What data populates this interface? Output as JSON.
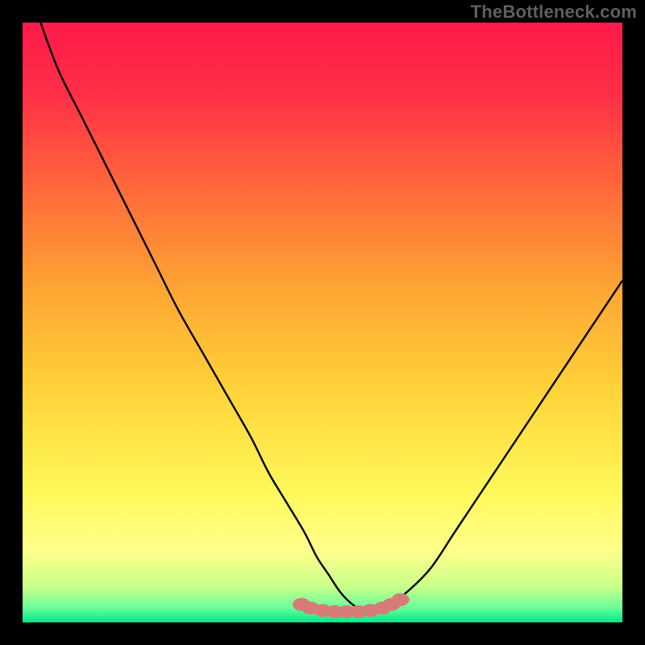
{
  "watermark": "TheBottleneck.com",
  "colors": {
    "background": "#000000",
    "gradient_stops": [
      {
        "offset": 0.0,
        "color": "#ff1a4a"
      },
      {
        "offset": 0.12,
        "color": "#ff2f47"
      },
      {
        "offset": 0.28,
        "color": "#ff6a3a"
      },
      {
        "offset": 0.45,
        "color": "#ffa733"
      },
      {
        "offset": 0.62,
        "color": "#ffd43a"
      },
      {
        "offset": 0.78,
        "color": "#fff85a"
      },
      {
        "offset": 0.88,
        "color": "#ffff8a"
      },
      {
        "offset": 0.94,
        "color": "#c9ff8a"
      },
      {
        "offset": 0.975,
        "color": "#6bff9a"
      },
      {
        "offset": 1.0,
        "color": "#00e88a"
      }
    ],
    "curve_stroke": "#000000",
    "marker_fill": "#d77b79"
  },
  "chart_data": {
    "type": "line",
    "title": "",
    "xlabel": "",
    "ylabel": "",
    "xlim": [
      0,
      100
    ],
    "ylim": [
      0,
      100
    ],
    "grid": false,
    "legend": false,
    "series": [
      {
        "name": "bottleneck-curve",
        "x": [
          3,
          6,
          10,
          14,
          18,
          22,
          26,
          30,
          34,
          38,
          41,
          44,
          47,
          49,
          51,
          53,
          55,
          57,
          59,
          61,
          64,
          68,
          72,
          76,
          80,
          84,
          88,
          92,
          96,
          100
        ],
        "y": [
          100,
          92,
          84,
          76,
          68,
          60,
          52,
          45,
          38,
          31,
          25,
          20,
          15,
          11,
          8,
          5,
          3,
          2,
          2,
          3,
          5,
          9,
          15,
          21,
          27,
          33,
          39,
          45,
          51,
          57
        ]
      }
    ],
    "annotations": [
      {
        "name": "bottom-markers",
        "type": "scatter",
        "x": [
          46.5,
          48,
          50,
          52,
          54,
          56,
          58,
          60,
          61.5,
          63
        ],
        "y": [
          3.0,
          2.4,
          2.0,
          1.8,
          1.8,
          1.8,
          2.0,
          2.4,
          3.0,
          3.8
        ]
      }
    ]
  }
}
